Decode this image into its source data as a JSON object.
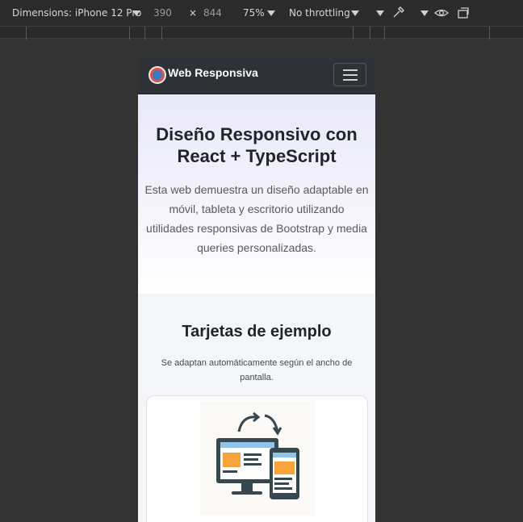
{
  "toolbar": {
    "dimensions_label": "Dimensions: iPhone 12 Pro",
    "width_value": "390",
    "times": "×",
    "height_value": "844",
    "zoom": "75%",
    "throttling": "No throttling"
  },
  "site": {
    "brand": "Web Responsiva",
    "hero": {
      "title_line1": "Diseño Responsivo con",
      "title_line2": "React + TypeScript",
      "description": "Esta web demuestra un diseño adaptable en móvil, tableta y escritorio utilizando utilidades responsivas de Bootstrap y media queries personalizadas."
    },
    "cards": {
      "title": "Tarjetas de ejemplo",
      "subtitle": "Se adaptan automáticamente según el ancho de pantalla."
    }
  },
  "colors": {
    "navbar": "#2e3136",
    "devtools_bg": "#333333",
    "illustration_blue": "#8fc3e8",
    "illustration_orange": "#f6a33b",
    "illustration_dark": "#37474f"
  }
}
